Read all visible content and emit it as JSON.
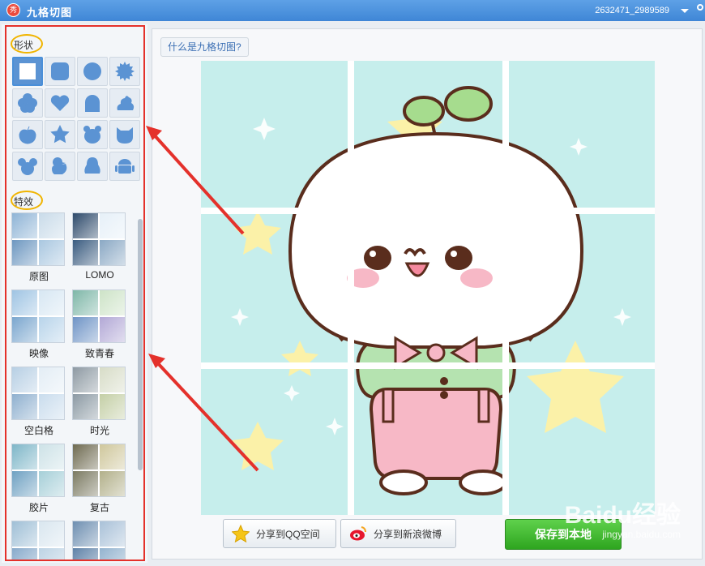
{
  "titlebar": {
    "app_icon_text": "秀",
    "title": "九格切图",
    "user_id": "2632471_2989589"
  },
  "left": {
    "shapes_label": "形状",
    "effects_label": "特效",
    "shapes": [
      "square",
      "rounded-square",
      "circle",
      "starburst",
      "flower",
      "heart",
      "arch",
      "blob",
      "apple",
      "star",
      "bear",
      "cat",
      "mouse",
      "duck",
      "penguin",
      "android"
    ],
    "selected_shape": "square",
    "effects": [
      {
        "name": "原图",
        "tint": [
          "#8fb4d6",
          "#c9dbe9",
          "#6d97c0",
          "#a9c7e0"
        ]
      },
      {
        "name": "LOMO",
        "tint": [
          "#2d4a6b",
          "#e6f0f8",
          "#3a5c80",
          "#8aa8c4"
        ]
      },
      {
        "name": "映像",
        "tint": [
          "#9fc4e3",
          "#d7e7f3",
          "#7aa6ce",
          "#b8d4ea"
        ]
      },
      {
        "name": "致青春",
        "tint": [
          "#7fb7a8",
          "#cde3c7",
          "#6f94c6",
          "#b2a8d6"
        ]
      },
      {
        "name": "空白格",
        "tint": [
          "#b7cfe4",
          "#e3edf5",
          "#8fb0cf",
          "#c9dced"
        ]
      },
      {
        "name": "时光",
        "tint": [
          "#8e9aa3",
          "#d7dcc7",
          "#8c9aa4",
          "#c4cfa6"
        ]
      },
      {
        "name": "胶片",
        "tint": [
          "#7eb6c8",
          "#cde2e7",
          "#6fa1c2",
          "#a6cfd8"
        ]
      },
      {
        "name": "复古",
        "tint": [
          "#6e6a50",
          "#cfc79c",
          "#7b7a62",
          "#b2b08a"
        ]
      },
      {
        "name": "",
        "tint": [
          "#9fbfd6",
          "#d9e6ef",
          "#88aacb",
          "#bdd3e4"
        ]
      },
      {
        "name": "",
        "tint": [
          "#6e8fb1",
          "#a9c1d8",
          "#5f82a8",
          "#93b3cf"
        ]
      }
    ]
  },
  "main": {
    "help_link": "什么是九格切图?",
    "share_qzone": "分享到QQ空间",
    "share_weibo": "分享到新浪微博",
    "save": "保存到本地"
  },
  "watermark": {
    "brand": "Baidu经验",
    "url": "jingyan.baidu.com"
  },
  "colors": {
    "titlebar": "#4a8fd8",
    "canvas_bg": "#c6eeec",
    "highlight_frame": "#e4312b",
    "label_ring": "#f0b400",
    "save_green": "#3dba2c"
  }
}
